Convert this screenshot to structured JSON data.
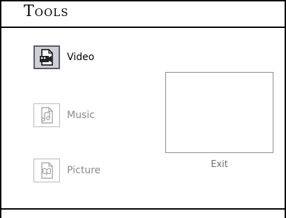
{
  "title": "Tools",
  "menu": [
    {
      "label": "Video",
      "icon": "video-file-icon",
      "selected": true
    },
    {
      "label": "Music",
      "icon": "music-file-icon",
      "selected": false
    },
    {
      "label": "Picture",
      "icon": "picture-file-icon",
      "selected": false
    }
  ],
  "preview": {
    "exit_label": "Exit"
  },
  "colors": {
    "frame": "#000000",
    "selected_bg": "#cfcfd8",
    "inactive_text": "#8a8a8a"
  }
}
